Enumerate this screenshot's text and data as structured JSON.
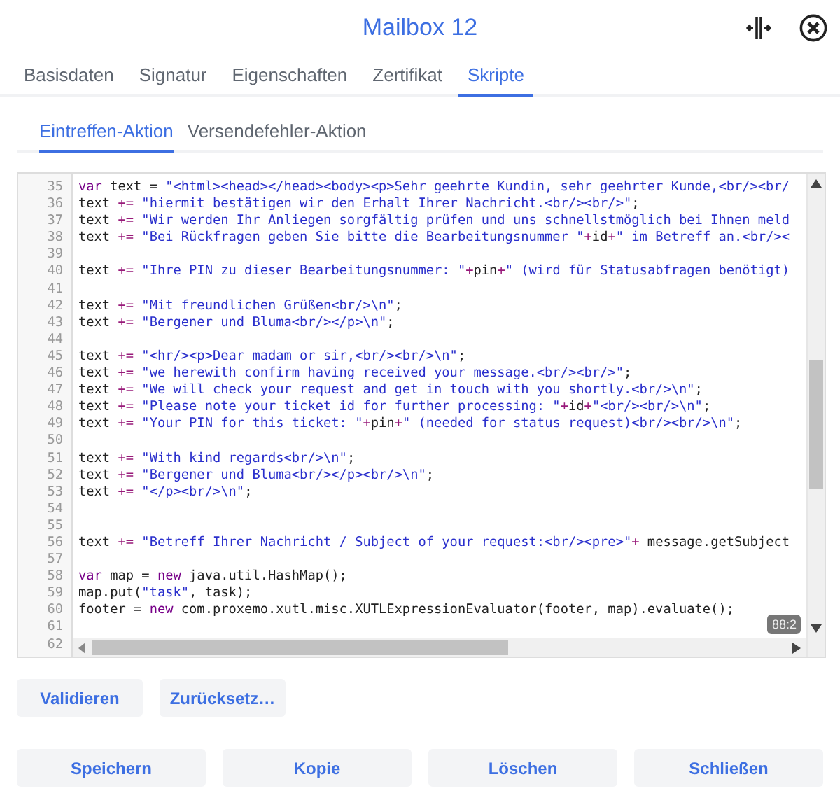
{
  "window": {
    "title": "Mailbox 12"
  },
  "tabs": [
    {
      "label": "Basisdaten",
      "selected": false
    },
    {
      "label": "Signatur",
      "selected": false
    },
    {
      "label": "Eigenschaften",
      "selected": false
    },
    {
      "label": "Zertifikat",
      "selected": false
    },
    {
      "label": "Skripte",
      "selected": true
    }
  ],
  "subtabs": [
    {
      "label": "Eintreffen-Aktion",
      "selected": true
    },
    {
      "label": "Versendefehler-Aktion",
      "selected": false
    }
  ],
  "editor": {
    "lines": [
      {
        "number": "35",
        "tokens": [
          {
            "kind": "keyword",
            "text": "var"
          },
          {
            "kind": "plain",
            "text": " text = "
          },
          {
            "kind": "string",
            "text": "\"<html><head></head><body><p>Sehr geehrte Kundin, sehr geehrter Kunde,<br/><br/"
          }
        ]
      },
      {
        "number": "36",
        "tokens": [
          {
            "kind": "plain",
            "text": "text "
          },
          {
            "kind": "operator",
            "text": "+="
          },
          {
            "kind": "string",
            "text": " \"hiermit bestätigen wir den Erhalt Ihrer Nachricht.<br/><br/>\""
          },
          {
            "kind": "plain",
            "text": ";"
          }
        ]
      },
      {
        "number": "37",
        "tokens": [
          {
            "kind": "plain",
            "text": "text "
          },
          {
            "kind": "operator",
            "text": "+="
          },
          {
            "kind": "string",
            "text": " \"Wir werden Ihr Anliegen sorgfältig prüfen und uns schnellstmöglich bei Ihnen meld"
          }
        ]
      },
      {
        "number": "38",
        "tokens": [
          {
            "kind": "plain",
            "text": "text "
          },
          {
            "kind": "operator",
            "text": "+="
          },
          {
            "kind": "string",
            "text": " \"Bei Rückfragen geben Sie bitte die Bearbeitungsnummer \""
          },
          {
            "kind": "operator",
            "text": "+"
          },
          {
            "kind": "plain",
            "text": "id"
          },
          {
            "kind": "operator",
            "text": "+"
          },
          {
            "kind": "string",
            "text": "\" im Betreff an.<br/><"
          }
        ]
      },
      {
        "number": "39"
      },
      {
        "number": "40",
        "tokens": [
          {
            "kind": "plain",
            "text": "text "
          },
          {
            "kind": "operator",
            "text": "+="
          },
          {
            "kind": "string",
            "text": " \"Ihre PIN zu dieser Bearbeitungsnummer: \""
          },
          {
            "kind": "operator",
            "text": "+"
          },
          {
            "kind": "plain",
            "text": "pin"
          },
          {
            "kind": "operator",
            "text": "+"
          },
          {
            "kind": "string",
            "text": "\" (wird für Statusabfragen benötigt)"
          }
        ]
      },
      {
        "number": "41"
      },
      {
        "number": "42",
        "tokens": [
          {
            "kind": "plain",
            "text": "text "
          },
          {
            "kind": "operator",
            "text": "+="
          },
          {
            "kind": "string",
            "text": " \"Mit freundlichen Grüßen<br/>\\n\""
          },
          {
            "kind": "plain",
            "text": ";"
          }
        ]
      },
      {
        "number": "43",
        "tokens": [
          {
            "kind": "plain",
            "text": "text "
          },
          {
            "kind": "operator",
            "text": "+="
          },
          {
            "kind": "string",
            "text": " \"Bergener und Bluma<br/></p>\\n\""
          },
          {
            "kind": "plain",
            "text": ";"
          }
        ]
      },
      {
        "number": "44"
      },
      {
        "number": "45",
        "tokens": [
          {
            "kind": "plain",
            "text": "text "
          },
          {
            "kind": "operator",
            "text": "+="
          },
          {
            "kind": "string",
            "text": " \"<hr/><p>Dear madam or sir,<br/><br/>\\n\""
          },
          {
            "kind": "plain",
            "text": ";"
          }
        ]
      },
      {
        "number": "46",
        "tokens": [
          {
            "kind": "plain",
            "text": "text "
          },
          {
            "kind": "operator",
            "text": "+="
          },
          {
            "kind": "string",
            "text": " \"we herewith confirm having received your message.<br/><br/>\""
          },
          {
            "kind": "plain",
            "text": ";"
          }
        ]
      },
      {
        "number": "47",
        "tokens": [
          {
            "kind": "plain",
            "text": "text "
          },
          {
            "kind": "operator",
            "text": "+="
          },
          {
            "kind": "string",
            "text": " \"We will check your request and get in touch with you shortly.<br/>\\n\""
          },
          {
            "kind": "plain",
            "text": ";"
          }
        ]
      },
      {
        "number": "48",
        "tokens": [
          {
            "kind": "plain",
            "text": "text "
          },
          {
            "kind": "operator",
            "text": "+="
          },
          {
            "kind": "string",
            "text": " \"Please note your ticket id for further processing: \""
          },
          {
            "kind": "operator",
            "text": "+"
          },
          {
            "kind": "plain",
            "text": "id"
          },
          {
            "kind": "operator",
            "text": "+"
          },
          {
            "kind": "string",
            "text": "\"<br/><br/>\\n\""
          },
          {
            "kind": "plain",
            "text": ";"
          }
        ]
      },
      {
        "number": "49",
        "tokens": [
          {
            "kind": "plain",
            "text": "text "
          },
          {
            "kind": "operator",
            "text": "+="
          },
          {
            "kind": "string",
            "text": " \"Your PIN for this ticket: \""
          },
          {
            "kind": "operator",
            "text": "+"
          },
          {
            "kind": "plain",
            "text": "pin"
          },
          {
            "kind": "operator",
            "text": "+"
          },
          {
            "kind": "string",
            "text": "\" (needed for status request)<br/><br/>\\n\""
          },
          {
            "kind": "plain",
            "text": ";"
          }
        ]
      },
      {
        "number": "50"
      },
      {
        "number": "51",
        "tokens": [
          {
            "kind": "plain",
            "text": "text "
          },
          {
            "kind": "operator",
            "text": "+="
          },
          {
            "kind": "string",
            "text": " \"With kind regards<br/>\\n\""
          },
          {
            "kind": "plain",
            "text": ";"
          }
        ]
      },
      {
        "number": "52",
        "tokens": [
          {
            "kind": "plain",
            "text": "text "
          },
          {
            "kind": "operator",
            "text": "+="
          },
          {
            "kind": "string",
            "text": " \"Bergener und Bluma<br/></p><br/>\\n\""
          },
          {
            "kind": "plain",
            "text": ";"
          }
        ]
      },
      {
        "number": "53",
        "tokens": [
          {
            "kind": "plain",
            "text": "text "
          },
          {
            "kind": "operator",
            "text": "+="
          },
          {
            "kind": "string",
            "text": " \"</p><br/>\\n\""
          },
          {
            "kind": "plain",
            "text": ";"
          }
        ]
      },
      {
        "number": "54"
      },
      {
        "number": "55"
      },
      {
        "number": "56",
        "tokens": [
          {
            "kind": "plain",
            "text": "text "
          },
          {
            "kind": "operator",
            "text": "+="
          },
          {
            "kind": "string",
            "text": " \"Betreff Ihrer Nachricht / Subject of your request:<br/><pre>\""
          },
          {
            "kind": "operator",
            "text": "+"
          },
          {
            "kind": "plain",
            "text": " message.getSubject"
          }
        ]
      },
      {
        "number": "57"
      },
      {
        "number": "58",
        "tokens": [
          {
            "kind": "keyword",
            "text": "var"
          },
          {
            "kind": "plain",
            "text": " map = "
          },
          {
            "kind": "keyword",
            "text": "new"
          },
          {
            "kind": "plain",
            "text": " java.util.HashMap();"
          }
        ]
      },
      {
        "number": "59",
        "tokens": [
          {
            "kind": "plain",
            "text": "map.put("
          },
          {
            "kind": "string",
            "text": "\"task\""
          },
          {
            "kind": "plain",
            "text": ", task);"
          }
        ]
      },
      {
        "number": "60",
        "tokens": [
          {
            "kind": "plain",
            "text": "footer = "
          },
          {
            "kind": "keyword",
            "text": "new"
          },
          {
            "kind": "plain",
            "text": " com.proxemo.xutl.misc.XUTLExpressionEvaluator(footer, map).evaluate();"
          }
        ]
      },
      {
        "number": "61"
      },
      {
        "number": "62"
      }
    ],
    "cursor_position": "88:2"
  },
  "action_buttons": [
    "Validieren",
    "Zurücksetz…"
  ],
  "footer_buttons": [
    "Speichern",
    "Kopie",
    "Löschen",
    "Schließen"
  ]
}
